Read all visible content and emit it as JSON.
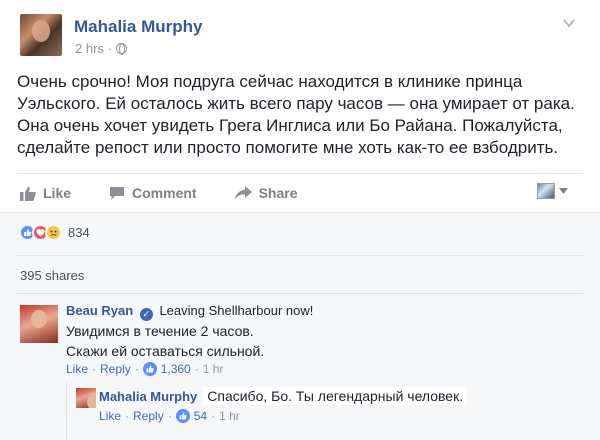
{
  "post": {
    "author": "Mahalia Murphy",
    "time": "2 hrs",
    "dot": "·",
    "text": "Очень срочно! Моя подруга сейчас находится в клинике принца Уэльского. Ей осталось жить всего пару часов — она умирает от рака. Она очень хочет увидеть Грега Инглиса или Бо Райана. Пожалуйста, сделайте репост или просто помогите мне хоть как-то ее взбодрить."
  },
  "actions": {
    "like": "Like",
    "comment": "Comment",
    "share": "Share"
  },
  "stats": {
    "reactions_count": "834",
    "shares": "395 shares"
  },
  "comments": [
    {
      "name": "Beau Ryan",
      "status": "Leaving Shellharbour now!",
      "line1": "Увидимся в течение 2 часов.",
      "line2": "Скажи ей оставаться сильной.",
      "like": "Like",
      "reply": "Reply",
      "likes": "1,360",
      "time": "1 hr"
    },
    {
      "name": "Mahalia Murphy",
      "text": "Спасибо, Бо. Ты легендарный человек.",
      "like": "Like",
      "reply": "Reply",
      "likes": "54",
      "time": "1 hr"
    }
  ],
  "colors": {
    "link": "#365899",
    "action_gray": "#7f7f7f",
    "like_blue": "#5890ff"
  }
}
